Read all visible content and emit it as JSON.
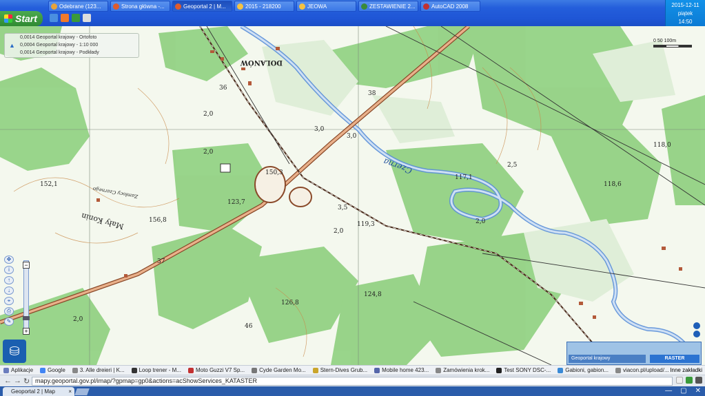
{
  "taskbar": {
    "start_label": "Start",
    "tasks": [
      {
        "label": "Odebrane (123...",
        "color": "#e8a33a"
      },
      {
        "label": "Strona główna -...",
        "color": "#e05b2c"
      },
      {
        "label": "Geoportal 2 | M...",
        "color": "#e05b2c",
        "active": true
      },
      {
        "label": "2015 - 218200",
        "color": "#f5c242"
      },
      {
        "label": "JEOWA",
        "color": "#f5c242"
      },
      {
        "label": "ZESTAWIENIE 2...",
        "color": "#3a8a3a"
      },
      {
        "label": "AutoCAD 2008",
        "color": "#c23131"
      }
    ],
    "tray": {
      "date": "2015-12-11",
      "day": "piątek",
      "time": "14:50"
    }
  },
  "map": {
    "layers": [
      "0,0014 Geoportal krajowy - Ortofoto",
      "0,0004 Geoportal krajowy - 1:10 000",
      "0,0014 Geoportal krajowy - Podkłady"
    ],
    "labels": {
      "town": "DOLANÓW",
      "river": "Czerna",
      "place1": "Mały Konin",
      "place2": "Zamłocy Czarnego",
      "h1": "2,0",
      "h2": "3,0",
      "h3": "3,0",
      "h4": "2,0",
      "h5": "3,5",
      "e1": "123,7",
      "e2": "150,3",
      "e3": "119,3",
      "e4": "118,6",
      "e5": "118,0",
      "e6": "126,8",
      "e7": "124,8",
      "e8": "156,8",
      "e9": "152,1",
      "e10": "117,1",
      "n1": "36",
      "n2": "38",
      "n3": "46",
      "n4": "37",
      "n5": "2,0",
      "n6": "2,5",
      "n7": "2,0",
      "n7b": "2,0"
    },
    "scale_label": "0    50    100m",
    "overview": {
      "status": "Geoportal krajowy",
      "button": "RASTER"
    }
  },
  "bookmarks": {
    "items": [
      {
        "label": "Aplikacje",
        "color": "#6b7dbd"
      },
      {
        "label": "Google",
        "color": "#4285f4"
      },
      {
        "label": "3. Alle dreieri | K...",
        "color": "#888"
      },
      {
        "label": "Loop trener - M...",
        "color": "#333"
      },
      {
        "label": "Moto Guzzi V7 Sp...",
        "color": "#c23131"
      },
      {
        "label": "Cyde Garden Mo...",
        "color": "#777"
      },
      {
        "label": "Stern-Dives Grub...",
        "color": "#caa52b"
      },
      {
        "label": "Mobile home 423...",
        "color": "#5566aa"
      },
      {
        "label": "Zamówienia krok...",
        "color": "#888"
      },
      {
        "label": "Test SONY DSC-...",
        "color": "#222"
      },
      {
        "label": "Gabioni, gabion...",
        "color": "#3a8ad6"
      },
      {
        "label": "viacon.pl/upload/...",
        "color": "#888"
      }
    ],
    "other": "Inne zakładki"
  },
  "address": {
    "url": "mapy.geoportal.gov.pl/imap/?gpmap=gp0&actions=acShowServices_KATASTER"
  },
  "tab": {
    "title": "Geoportal 2 | Map",
    "close": "×"
  }
}
